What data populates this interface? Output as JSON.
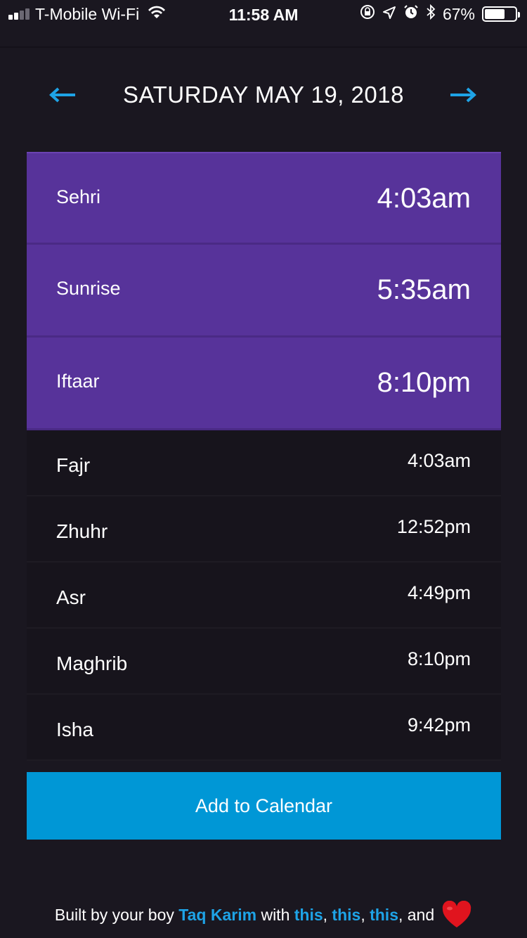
{
  "status_bar": {
    "carrier": "T-Mobile Wi-Fi",
    "time": "11:58 AM",
    "battery_percent": "67%",
    "battery_level": 0.67,
    "signal_bars": 2
  },
  "header": {
    "date": "SATURDAY MAY 19, 2018",
    "prev_icon": "arrow-left-icon",
    "next_icon": "arrow-right-icon"
  },
  "ramadan_times": [
    {
      "label": "Sehri",
      "time": "4:03am"
    },
    {
      "label": "Sunrise",
      "time": "5:35am"
    },
    {
      "label": "Iftaar",
      "time": "8:10pm"
    }
  ],
  "prayer_times": [
    {
      "label": "Fajr",
      "time": "4:03am"
    },
    {
      "label": "Zhuhr",
      "time": "12:52pm"
    },
    {
      "label": "Asr",
      "time": "4:49pm"
    },
    {
      "label": "Maghrib",
      "time": "8:10pm"
    },
    {
      "label": "Isha",
      "time": "9:42pm"
    }
  ],
  "add_button": "Add to Calendar",
  "footer": {
    "prefix": "Built by your boy ",
    "author": "Taq Karim",
    "mid": " with ",
    "link1": "this",
    "sep1": ", ",
    "link2": "this",
    "sep2": ", ",
    "link3": "this",
    "suffix": ", and",
    "heart_icon": "heart-icon"
  },
  "colors": {
    "background": "#1a1720",
    "purple": "#57339a",
    "accent_blue": "#0097d6",
    "link_blue": "#1ea3e6",
    "heart_red": "#e0141e"
  }
}
